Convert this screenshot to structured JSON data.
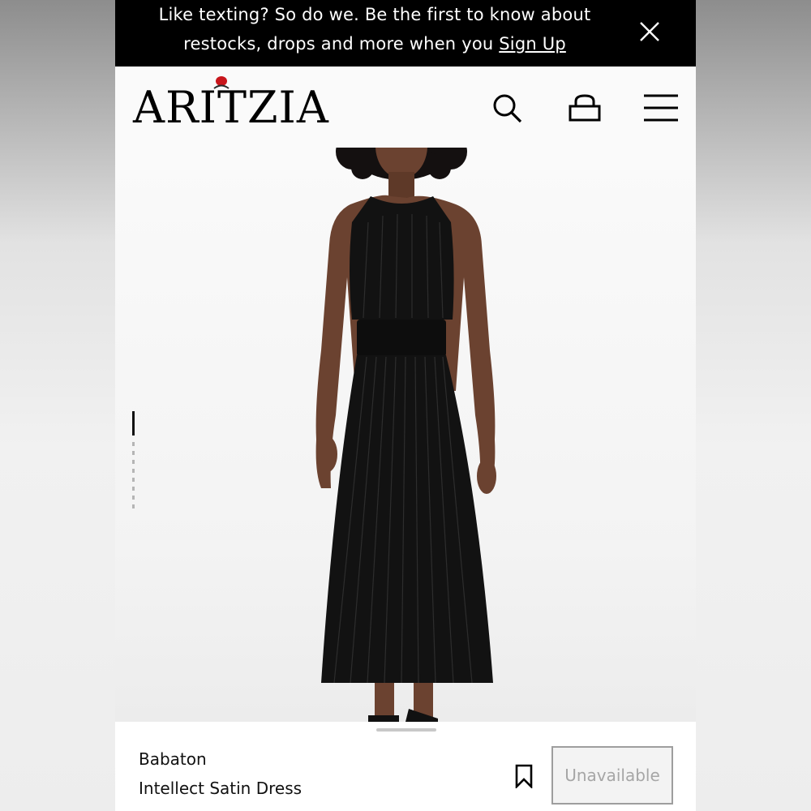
{
  "promo": {
    "line1": "Like texting? So do we. Be the first to know about",
    "line2_prefix": "restocks, drops and more when you ",
    "signup_link": "Sign Up",
    "close_icon": "close-icon"
  },
  "header": {
    "logo_text": "ARITZIA",
    "icons": [
      "search-icon",
      "shopping-bag-icon",
      "menu-icon"
    ]
  },
  "hero": {
    "image_subject": "model wearing black pleated satin halter midi dress",
    "carousel": {
      "total_slides": 5,
      "active_index": 0
    }
  },
  "product": {
    "brand": "Babaton",
    "name": "Intellect Satin Dress",
    "wishlist_icon": "bookmark-icon",
    "status_button": "Unavailable"
  },
  "colors": {
    "banner_bg": "#000000",
    "banner_text": "#ffffff",
    "dress": "#121212",
    "skin": "#6b4230",
    "hair": "#141010",
    "logo_rose": "#c8151b",
    "disabled_text": "#a6a6a6",
    "disabled_border": "#9e9e9e"
  }
}
